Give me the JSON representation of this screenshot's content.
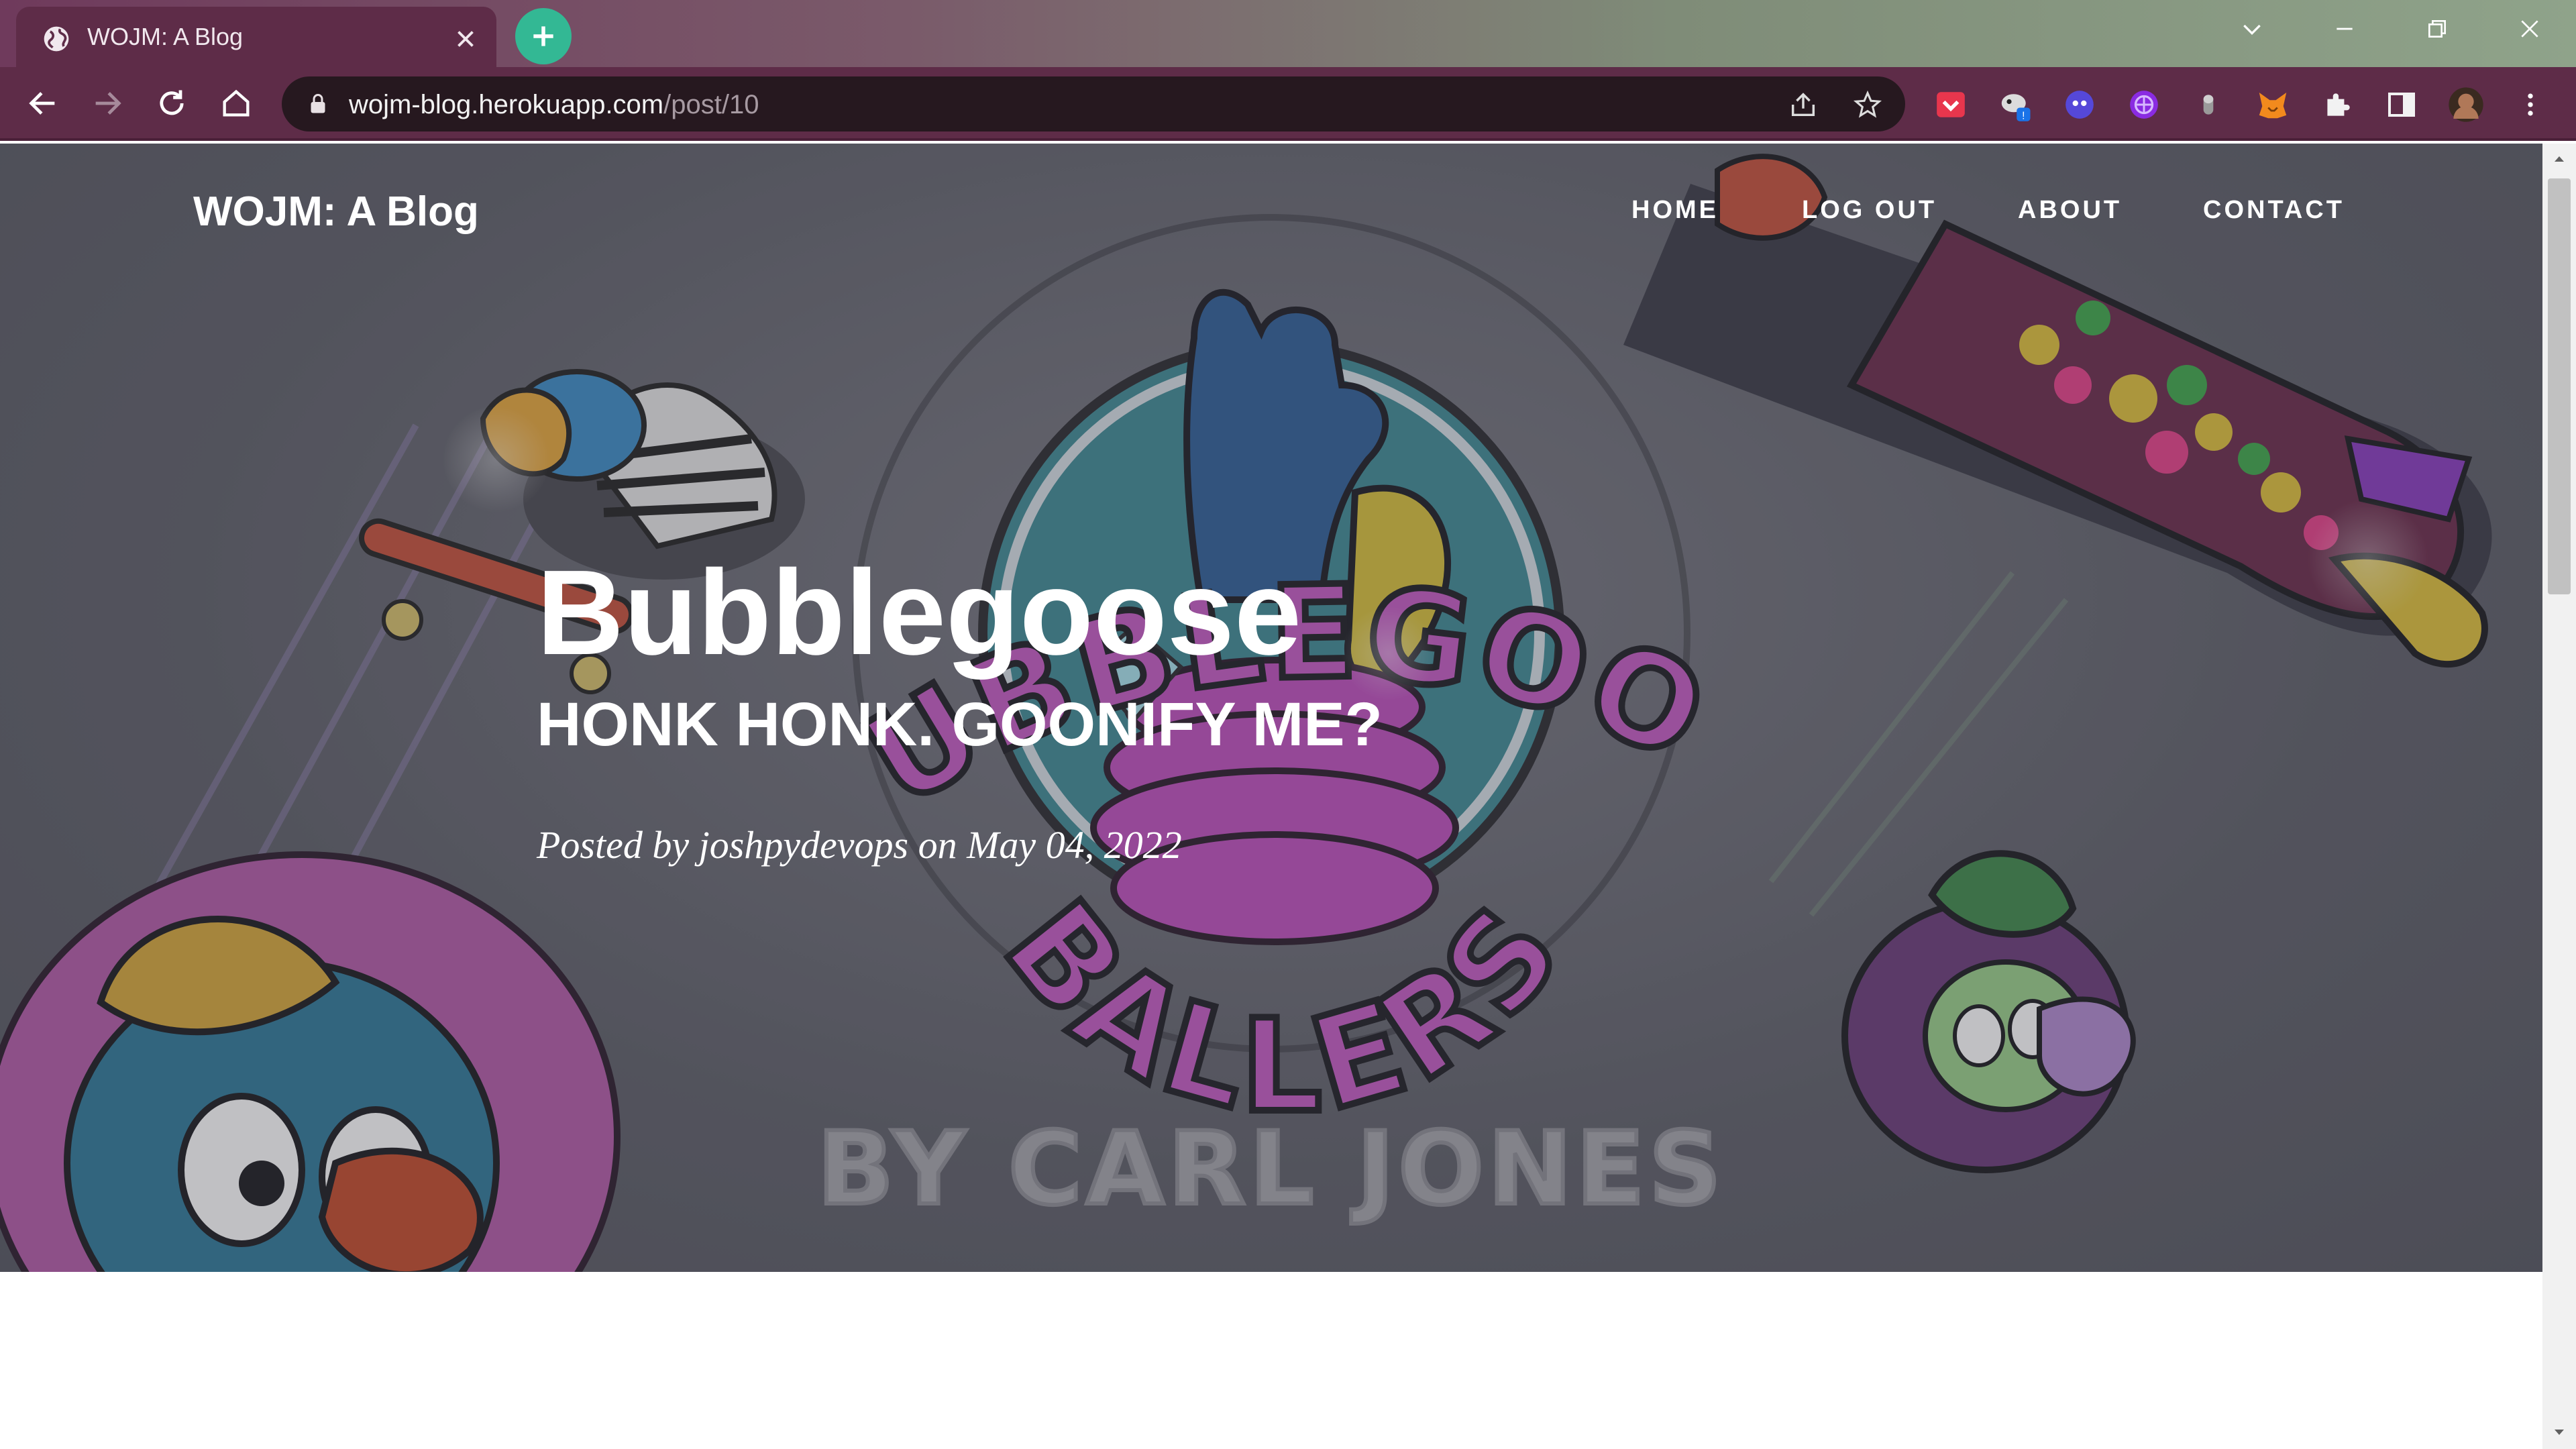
{
  "browser": {
    "tab_title": "WOJM: A Blog",
    "url_host": "wojm-blog.herokuapp.com",
    "url_path": "/post/10",
    "accent_new_tab": "#33b894",
    "chrome_color": "#5e2c48"
  },
  "site": {
    "brand": "WOJM: A Blog",
    "nav": [
      "HOME",
      "LOG OUT",
      "ABOUT",
      "CONTACT"
    ]
  },
  "post": {
    "title": "Bubblegoose",
    "subtitle": "HONK HONK. GOONIFY ME?",
    "meta": "Posted by joshpydevops on May 04, 2022"
  },
  "hero_art": {
    "ring_top_text": "BUBBLEGOOSE",
    "ring_bottom_text": "BALLERS",
    "byline": "BY CARL JONES"
  }
}
